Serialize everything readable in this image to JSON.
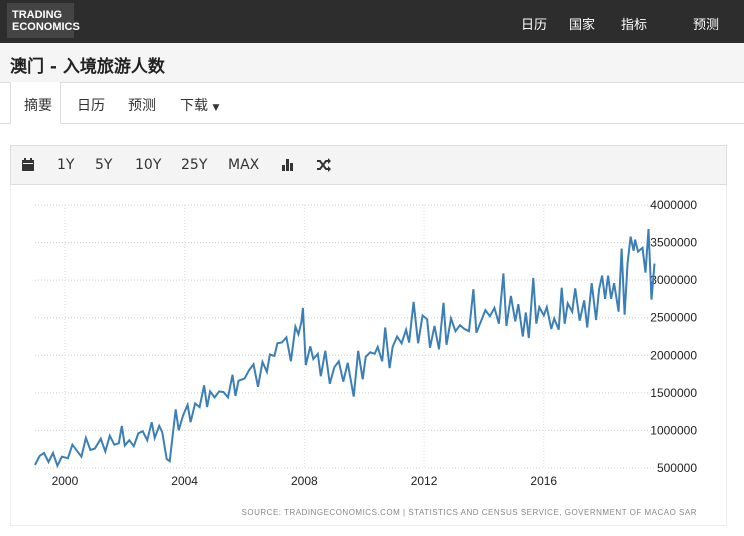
{
  "header": {
    "logo": "TRADING ECONOMICS",
    "logo_line1": "TRADING",
    "logo_line2": "ECONOMICS",
    "nav": [
      "日历",
      "国家",
      "指标",
      "预测"
    ]
  },
  "page_title": "澳门 - 入境旅游人数",
  "tabs": [
    "摘要",
    "日历",
    "预测",
    "下载"
  ],
  "toolbar": {
    "ranges": [
      "1Y",
      "5Y",
      "10Y",
      "25Y",
      "MAX"
    ]
  },
  "colors": {
    "line": "#3b7fb6",
    "header": "#2d2d2d"
  },
  "chart_data": {
    "type": "line",
    "title": "澳门 - 入境旅游人数",
    "xlabel": "",
    "ylabel": "",
    "x_ticks": [
      "2000",
      "2004",
      "2008",
      "2012",
      "2016"
    ],
    "y_ticks": [
      "500000",
      "1000000",
      "1500000",
      "2000000",
      "2500000",
      "3000000",
      "3500000",
      "4000000"
    ],
    "xlim": [
      1999.0,
      2019.75
    ],
    "ylim": [
      500000,
      4000000
    ],
    "grid": true,
    "source": "SOURCE: TRADINGECONOMICS.COM | STATISTICS AND CENSUS SERVICE, GOVERNMENT OF MACAO SAR",
    "series": [
      {
        "name": "入境旅游人数",
        "points": [
          [
            1999.0,
            540000
          ],
          [
            1999.15,
            660000
          ],
          [
            1999.3,
            700000
          ],
          [
            1999.45,
            580000
          ],
          [
            1999.6,
            700000
          ],
          [
            1999.75,
            530000
          ],
          [
            1999.9,
            650000
          ],
          [
            2000.1,
            630000
          ],
          [
            2000.25,
            810000
          ],
          [
            2000.4,
            730000
          ],
          [
            2000.55,
            650000
          ],
          [
            2000.7,
            900000
          ],
          [
            2000.85,
            740000
          ],
          [
            2001.0,
            760000
          ],
          [
            2001.2,
            890000
          ],
          [
            2001.35,
            720000
          ],
          [
            2001.5,
            930000
          ],
          [
            2001.65,
            810000
          ],
          [
            2001.8,
            830000
          ],
          [
            2001.9,
            1060000
          ],
          [
            2002.0,
            800000
          ],
          [
            2002.15,
            870000
          ],
          [
            2002.3,
            790000
          ],
          [
            2002.45,
            960000
          ],
          [
            2002.6,
            990000
          ],
          [
            2002.75,
            870000
          ],
          [
            2002.9,
            1110000
          ],
          [
            2003.0,
            900000
          ],
          [
            2003.15,
            1060000
          ],
          [
            2003.25,
            980000
          ],
          [
            2003.4,
            620000
          ],
          [
            2003.5,
            590000
          ],
          [
            2003.7,
            1280000
          ],
          [
            2003.8,
            1000000
          ],
          [
            2003.95,
            1200000
          ],
          [
            2004.1,
            1340000
          ],
          [
            2004.2,
            1110000
          ],
          [
            2004.35,
            1360000
          ],
          [
            2004.5,
            1310000
          ],
          [
            2004.65,
            1600000
          ],
          [
            2004.75,
            1310000
          ],
          [
            2004.85,
            1520000
          ],
          [
            2005.0,
            1440000
          ],
          [
            2005.15,
            1520000
          ],
          [
            2005.3,
            1510000
          ],
          [
            2005.45,
            1440000
          ],
          [
            2005.6,
            1740000
          ],
          [
            2005.7,
            1460000
          ],
          [
            2005.8,
            1660000
          ],
          [
            2006.0,
            1690000
          ],
          [
            2006.15,
            1800000
          ],
          [
            2006.3,
            1880000
          ],
          [
            2006.45,
            1580000
          ],
          [
            2006.6,
            1910000
          ],
          [
            2006.75,
            1780000
          ],
          [
            2006.85,
            2010000
          ],
          [
            2007.0,
            1990000
          ],
          [
            2007.1,
            2160000
          ],
          [
            2007.25,
            2170000
          ],
          [
            2007.4,
            2240000
          ],
          [
            2007.55,
            1920000
          ],
          [
            2007.7,
            2380000
          ],
          [
            2007.8,
            2280000
          ],
          [
            2007.9,
            2440000
          ],
          [
            2007.95,
            2630000
          ],
          [
            2008.05,
            1870000
          ],
          [
            2008.2,
            2120000
          ],
          [
            2008.3,
            1950000
          ],
          [
            2008.45,
            2020000
          ],
          [
            2008.55,
            1720000
          ],
          [
            2008.7,
            2060000
          ],
          [
            2008.85,
            1620000
          ],
          [
            2009.0,
            1840000
          ],
          [
            2009.15,
            1920000
          ],
          [
            2009.3,
            1650000
          ],
          [
            2009.45,
            1900000
          ],
          [
            2009.65,
            1450000
          ],
          [
            2009.8,
            2060000
          ],
          [
            2009.95,
            1680000
          ],
          [
            2010.05,
            1980000
          ],
          [
            2010.2,
            2040000
          ],
          [
            2010.35,
            2020000
          ],
          [
            2010.45,
            2110000
          ],
          [
            2010.6,
            1920000
          ],
          [
            2010.7,
            2370000
          ],
          [
            2010.85,
            1830000
          ],
          [
            2010.95,
            2110000
          ],
          [
            2011.1,
            2250000
          ],
          [
            2011.25,
            2160000
          ],
          [
            2011.4,
            2340000
          ],
          [
            2011.5,
            2170000
          ],
          [
            2011.65,
            2710000
          ],
          [
            2011.8,
            2160000
          ],
          [
            2011.95,
            2530000
          ],
          [
            2012.1,
            2480000
          ],
          [
            2012.2,
            2100000
          ],
          [
            2012.35,
            2390000
          ],
          [
            2012.5,
            2080000
          ],
          [
            2012.65,
            2700000
          ],
          [
            2012.75,
            2140000
          ],
          [
            2012.9,
            2490000
          ],
          [
            2013.05,
            2320000
          ],
          [
            2013.2,
            2400000
          ],
          [
            2013.35,
            2350000
          ],
          [
            2013.5,
            2320000
          ],
          [
            2013.65,
            2880000
          ],
          [
            2013.75,
            2300000
          ],
          [
            2013.9,
            2450000
          ],
          [
            2014.05,
            2600000
          ],
          [
            2014.2,
            2520000
          ],
          [
            2014.35,
            2630000
          ],
          [
            2014.5,
            2420000
          ],
          [
            2014.65,
            3090000
          ],
          [
            2014.75,
            2390000
          ],
          [
            2014.9,
            2790000
          ],
          [
            2015.05,
            2450000
          ],
          [
            2015.15,
            2680000
          ],
          [
            2015.3,
            2250000
          ],
          [
            2015.4,
            2570000
          ],
          [
            2015.5,
            2230000
          ],
          [
            2015.65,
            3030000
          ],
          [
            2015.75,
            2420000
          ],
          [
            2015.85,
            2640000
          ],
          [
            2016.0,
            2530000
          ],
          [
            2016.1,
            2640000
          ],
          [
            2016.25,
            2350000
          ],
          [
            2016.35,
            2490000
          ],
          [
            2016.5,
            2340000
          ],
          [
            2016.6,
            2900000
          ],
          [
            2016.7,
            2420000
          ],
          [
            2016.8,
            2690000
          ],
          [
            2016.95,
            2580000
          ],
          [
            2017.05,
            2890000
          ],
          [
            2017.2,
            2460000
          ],
          [
            2017.35,
            2730000
          ],
          [
            2017.45,
            2370000
          ],
          [
            2017.6,
            2960000
          ],
          [
            2017.75,
            2470000
          ],
          [
            2017.85,
            2880000
          ],
          [
            2017.95,
            3060000
          ],
          [
            2018.05,
            2750000
          ],
          [
            2018.15,
            3060000
          ],
          [
            2018.25,
            2750000
          ],
          [
            2018.35,
            2960000
          ],
          [
            2018.5,
            2580000
          ],
          [
            2018.6,
            3420000
          ],
          [
            2018.7,
            2540000
          ],
          [
            2018.8,
            3230000
          ],
          [
            2018.9,
            3580000
          ],
          [
            2019.0,
            3390000
          ],
          [
            2019.05,
            3540000
          ],
          [
            2019.15,
            3380000
          ],
          [
            2019.3,
            3430000
          ],
          [
            2019.4,
            3100000
          ],
          [
            2019.5,
            3680000
          ],
          [
            2019.6,
            2740000
          ],
          [
            2019.7,
            3220000
          ]
        ]
      }
    ]
  }
}
